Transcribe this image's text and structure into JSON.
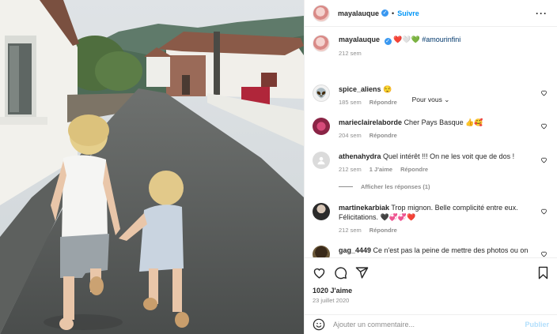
{
  "post": {
    "username": "mayalauque",
    "follow_label": "Suivre",
    "caption": "❤️🤍💚 #amourinfini",
    "caption_hashtag": "#amourinfini",
    "caption_emojis": "❤️🤍💚",
    "caption_age": "212 sem",
    "for_you_label": "Pour vous",
    "likes": "1020 J'aime",
    "date": "23 juillet 2020"
  },
  "comments": [
    {
      "username": "spice_aliens",
      "text": "😌",
      "age": "185 sem",
      "likes": "",
      "reply": "Répondre"
    },
    {
      "username": "marieclairelaborde",
      "text": "Cher Pays Basque 👍🥰",
      "age": "204 sem",
      "likes": "",
      "reply": "Répondre"
    },
    {
      "username": "athenahydra",
      "text": "Quel intérêt !!! On ne les voit que de dos !",
      "age": "212 sem",
      "likes": "1 J'aime",
      "reply": "Répondre"
    },
    {
      "username": "martinekarbiak",
      "text": "Trop mignon. Belle complicité entre eux. Félicitations. 🖤💞💞❤️",
      "age": "212 sem",
      "likes": "",
      "reply": "Répondre"
    },
    {
      "username": "gag_4449",
      "text": "Ce n'est pas la peine de mettre des photos ou on",
      "age": "",
      "likes": "",
      "reply": ""
    }
  ],
  "view_replies_label": "Afficher les réponses (1)",
  "composer": {
    "placeholder": "Ajouter un commentaire...",
    "publish_label": "Publier"
  },
  "icons": [
    "heart-icon",
    "comment-icon",
    "share-icon",
    "bookmark-icon",
    "emoji-icon",
    "more-icon",
    "verified-icon"
  ],
  "colors": {
    "link": "#0095f6",
    "hashtag": "#00376b",
    "muted": "#8e8e8e",
    "publish_disabled": "#b2dffc"
  }
}
